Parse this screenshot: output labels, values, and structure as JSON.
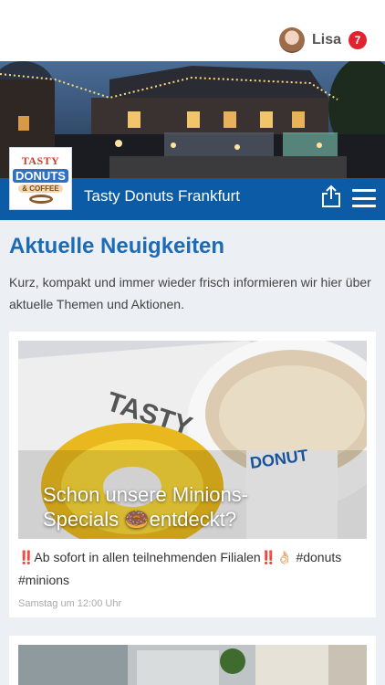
{
  "user": {
    "name": "Lisa",
    "notifications": "7"
  },
  "store": {
    "name": "Tasty Donuts Frankfurt",
    "logo": {
      "line1": "TASTY",
      "line2": "DONUTS",
      "line3": "& COFFEE"
    }
  },
  "news": {
    "title": "Aktuelle Neuigkeiten",
    "description": "Kurz, kompakt und immer wieder frisch informieren wir hier über aktuelle Themen und Aktionen.",
    "posts": [
      {
        "title": "Schon unsere Minions-Specials 🍩entdeckt?",
        "text": "‼️Ab sofort in allen teilnehmenden Filialen‼️👌🏻 #donuts #minions",
        "time": "Samstag um 12:00 Uhr",
        "image_text": "TASTY"
      }
    ]
  },
  "colors": {
    "header": "#0c5ba6",
    "title": "#1d6bb5",
    "badge": "#e0232e"
  }
}
